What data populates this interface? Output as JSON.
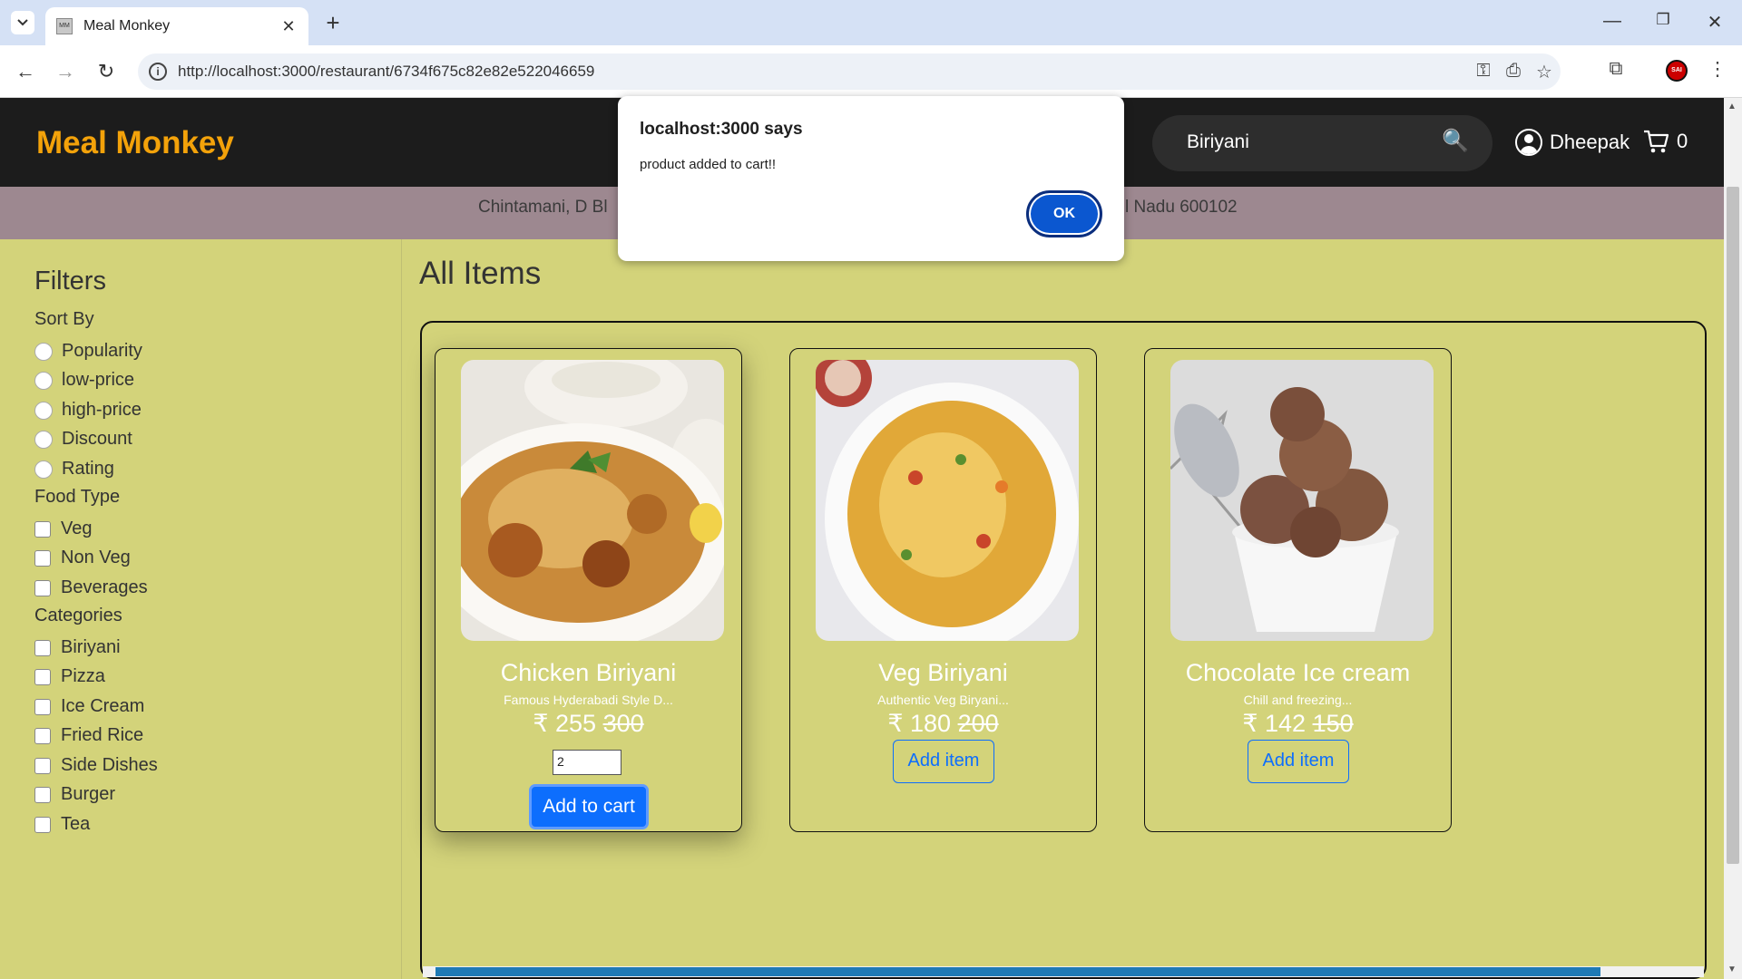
{
  "browser": {
    "tab_title": "Meal Monkey",
    "favicon_text": "MM",
    "url": "http://localhost:3000/restaurant/6734f675c82e82e522046659",
    "profile_text": "SAI"
  },
  "header": {
    "brand": "Meal Monkey",
    "search_value": "Biriyani",
    "user_name": "Dheepak",
    "cart_count": "0"
  },
  "address": "Chintamani, D Bl",
  "address_end": "l Nadu 600102",
  "filters": {
    "title": "Filters",
    "sort_label": "Sort By",
    "sort_options": [
      "Popularity",
      "low-price",
      "high-price",
      "Discount",
      "Rating"
    ],
    "food_type_label": "Food Type",
    "food_types": [
      "Veg",
      "Non Veg",
      "Beverages"
    ],
    "categories_label": "Categories",
    "categories": [
      "Biriyani",
      "Pizza",
      "Ice Cream",
      "Fried Rice",
      "Side Dishes",
      "Burger",
      "Tea"
    ]
  },
  "main": {
    "title": "All Items",
    "items": [
      {
        "name": "Chicken Biriyani",
        "desc": "Famous Hyderabadi Style D...",
        "price": "₹ 255",
        "old_price": "300",
        "qty": "2",
        "button": "Add to cart"
      },
      {
        "name": "Veg Biriyani",
        "desc": "Authentic Veg Biryani...",
        "price": "₹ 180",
        "old_price": "200",
        "button": "Add item"
      },
      {
        "name": "Chocolate Ice cream",
        "desc": "Chill and freezing...",
        "price": "₹ 142",
        "old_price": "150",
        "button": "Add item"
      }
    ]
  },
  "alert": {
    "title": "localhost:3000 says",
    "message": "product added to cart!!",
    "ok_label": "OK"
  }
}
